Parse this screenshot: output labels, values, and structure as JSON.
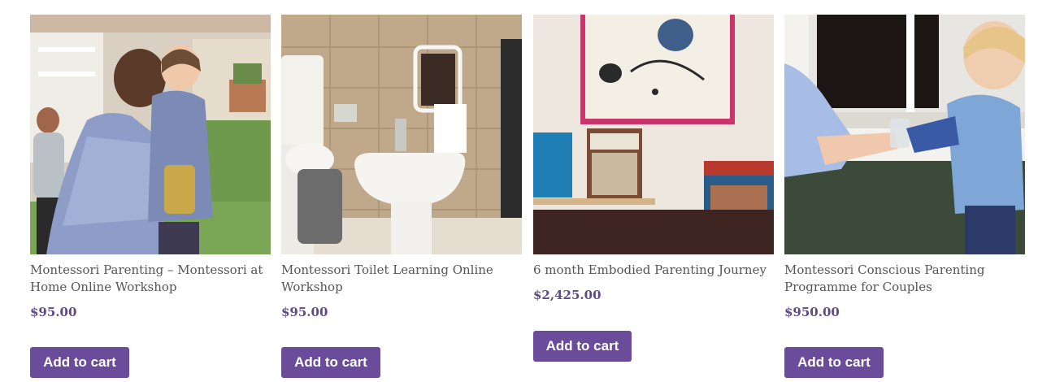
{
  "products": [
    {
      "title": "Montessori Parenting – Montessori at Home Online Workshop",
      "price": "$95.00",
      "button": "Add to cart",
      "image": "children-playing-garden-photo"
    },
    {
      "title": "Montessori Toilet Learning Online Workshop",
      "price": "$95.00",
      "button": "Add to cart",
      "image": "bathroom-bidet-photo"
    },
    {
      "title": "6 month Embodied Parenting Journey",
      "price": "$2,425.00",
      "button": "Add to cart",
      "image": "wall-art-bookshelf-photo"
    },
    {
      "title": "Montessori Conscious Parenting Programme for Couples",
      "price": "$950.00",
      "button": "Add to cart",
      "image": "toddler-glass-hands-photo"
    }
  ],
  "colors": {
    "price": "#5e4a85",
    "button_bg": "#6b4c9a",
    "title": "#555555"
  }
}
